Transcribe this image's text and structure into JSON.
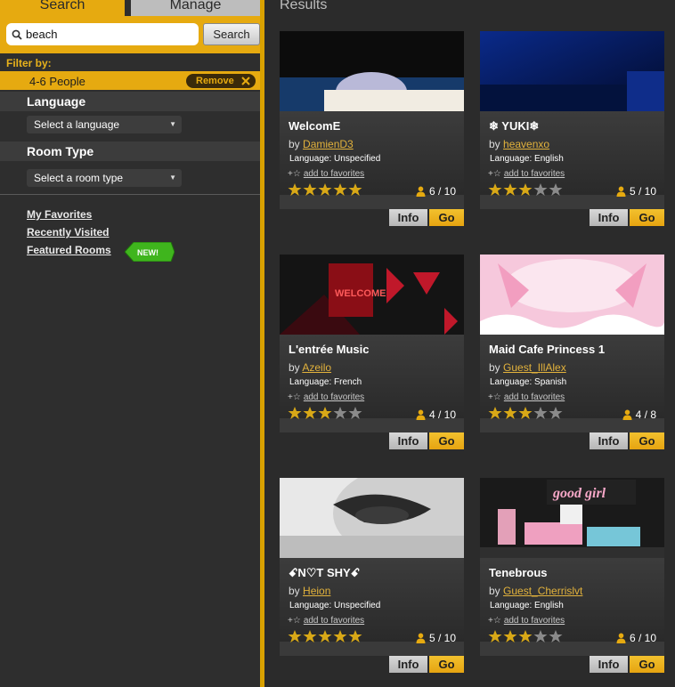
{
  "tabs": {
    "search": "Search",
    "manage": "Manage"
  },
  "search": {
    "value": "beach",
    "button": "Search"
  },
  "filter": {
    "label": "Filter by:",
    "active": "4-6 People",
    "remove": "Remove"
  },
  "language": {
    "heading": "Language",
    "select": "Select a language"
  },
  "room_type": {
    "heading": "Room Type",
    "select": "Select a room type"
  },
  "links": {
    "favorites": "My Favorites",
    "recent": "Recently Visited",
    "featured": "Featured Rooms",
    "new_badge": "NEW!"
  },
  "results_title": "Results",
  "colors": {
    "accent": "#e6aa10",
    "star_on": "#d8a817",
    "star_off": "#8a8a8a"
  },
  "rooms": [
    {
      "name": "WelcomE",
      "by": "by",
      "owner": "DamienD3",
      "language": "Language: Unspecified",
      "fav": "add to favorites",
      "rating": 5,
      "occupancy": "6 / 10",
      "info": "Info",
      "go": "Go"
    },
    {
      "name": "❄ YUKI❄",
      "by": "by",
      "owner": "heavenxo",
      "language": "Language: English",
      "fav": "add to favorites",
      "rating": 3,
      "occupancy": "5 / 10",
      "info": "Info",
      "go": "Go"
    },
    {
      "name": "L'entrée Music",
      "by": "by",
      "owner": "Azeilo",
      "language": "Language: French",
      "fav": "add to favorites",
      "rating": 3,
      "occupancy": "4 / 10",
      "info": "Info",
      "go": "Go"
    },
    {
      "name": "Maid Cafe Princess 1",
      "by": "by",
      "owner": "Guest_IllAlex",
      "language": "Language: Spanish",
      "fav": "add to favorites",
      "rating": 3,
      "occupancy": "4 / 8",
      "info": "Info",
      "go": "Go"
    },
    {
      "name": "ꗃN♡T SHYꗃ",
      "by": "by",
      "owner": "Heion",
      "language": "Language: Unspecified",
      "fav": "add to favorites",
      "rating": 5,
      "occupancy": "5 / 10",
      "info": "Info",
      "go": "Go"
    },
    {
      "name": "Tenebrous",
      "by": "by",
      "owner": "Guest_Cherrislvt",
      "language": "Language: English",
      "fav": "add to favorites",
      "rating": 3,
      "occupancy": "6 / 10",
      "info": "Info",
      "go": "Go"
    }
  ]
}
